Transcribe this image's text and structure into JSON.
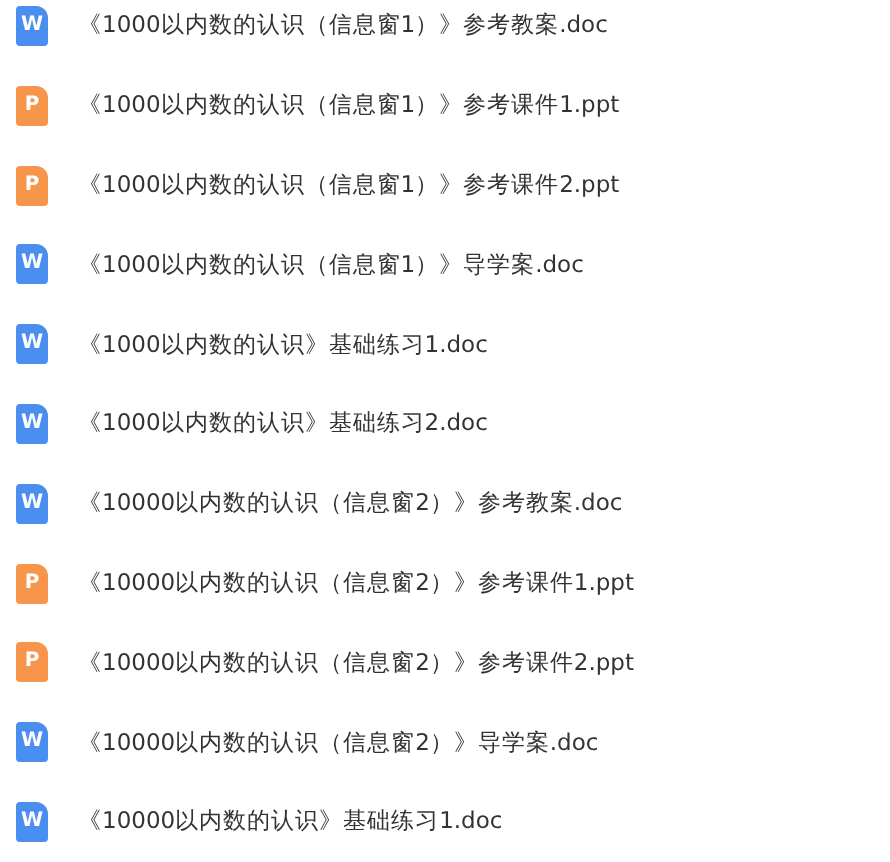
{
  "files": [
    {
      "kind": "doc",
      "icon_letter": "W",
      "name": "《1000以内数的认识（信息窗1）》参考教案.doc"
    },
    {
      "kind": "ppt",
      "icon_letter": "P",
      "name": "《1000以内数的认识（信息窗1）》参考课件1.ppt"
    },
    {
      "kind": "ppt",
      "icon_letter": "P",
      "name": "《1000以内数的认识（信息窗1）》参考课件2.ppt"
    },
    {
      "kind": "doc",
      "icon_letter": "W",
      "name": "《1000以内数的认识（信息窗1）》导学案.doc"
    },
    {
      "kind": "doc",
      "icon_letter": "W",
      "name": "《1000以内数的认识》基础练习1.doc"
    },
    {
      "kind": "doc",
      "icon_letter": "W",
      "name": "《1000以内数的认识》基础练习2.doc"
    },
    {
      "kind": "doc",
      "icon_letter": "W",
      "name": "《10000以内数的认识（信息窗2）》参考教案.doc"
    },
    {
      "kind": "ppt",
      "icon_letter": "P",
      "name": "《10000以内数的认识（信息窗2）》参考课件1.ppt"
    },
    {
      "kind": "ppt",
      "icon_letter": "P",
      "name": "《10000以内数的认识（信息窗2）》参考课件2.ppt"
    },
    {
      "kind": "doc",
      "icon_letter": "W",
      "name": "《10000以内数的认识（信息窗2）》导学案.doc"
    },
    {
      "kind": "doc",
      "icon_letter": "W",
      "name": "《10000以内数的认识》基础练习1.doc"
    }
  ]
}
